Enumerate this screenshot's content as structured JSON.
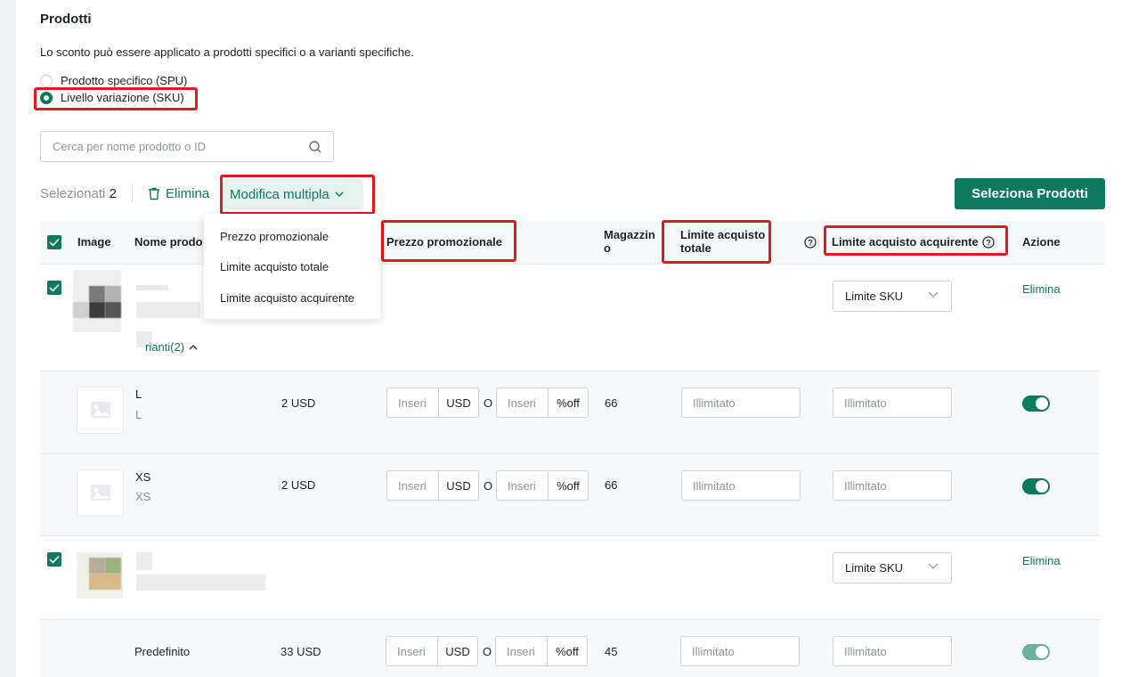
{
  "section": {
    "title": "Prodotti",
    "description": "Lo sconto può essere applicato a prodotti specifici o a varianti specifiche."
  },
  "scope": {
    "options": [
      {
        "label": "Prodotto specifico (SPU)",
        "selected": false
      },
      {
        "label": "Livello variazione (SKU)",
        "selected": true
      }
    ]
  },
  "search": {
    "placeholder": "Cerca per nome prodotto o ID"
  },
  "toolbar": {
    "selected_label": "Selezionati",
    "selected_count": "2",
    "delete_label": "Elimina",
    "bulk_edit_label": "Modifica multipla",
    "select_products_label": "Seleziona Prodotti"
  },
  "bulk_menu": {
    "items": [
      "Prezzo promozionale",
      "Limite acquisto totale",
      "Limite acquisto acquirente"
    ]
  },
  "table": {
    "headers": {
      "image": "Image",
      "name": "Nome prodo",
      "promo_price": "Prezzo promozionale",
      "stock_1": "Magazzin",
      "stock_2": "o",
      "total_limit_1": "Limite acquisto",
      "total_limit_2": "totale",
      "buyer_limit": "Limite acquisto acquirente",
      "action": "Azione"
    },
    "products": [
      {
        "select_value": "Limite SKU",
        "action_label": "Elimina",
        "variants_toggle": "rianti(2)"
      },
      {
        "select_value": "Limite SKU",
        "action_label": "Elimina"
      }
    ],
    "variants": [
      {
        "name": "L",
        "sub": "L",
        "price": "2 USD",
        "stock": "66"
      },
      {
        "name": "XS",
        "sub": "XS",
        "price": "2 USD",
        "stock": "66"
      },
      {
        "name": "Predefinito",
        "price": "33 USD",
        "stock": "45"
      }
    ],
    "inputs": {
      "price_placeholder": "Inseri",
      "currency": "USD",
      "or": "O",
      "percent_placeholder": "Inseri",
      "percent_suffix": "%off",
      "limit_placeholder": "Illimitato"
    }
  },
  "colors": {
    "accent": "#0d7a5f",
    "highlight": "#e3191e"
  }
}
